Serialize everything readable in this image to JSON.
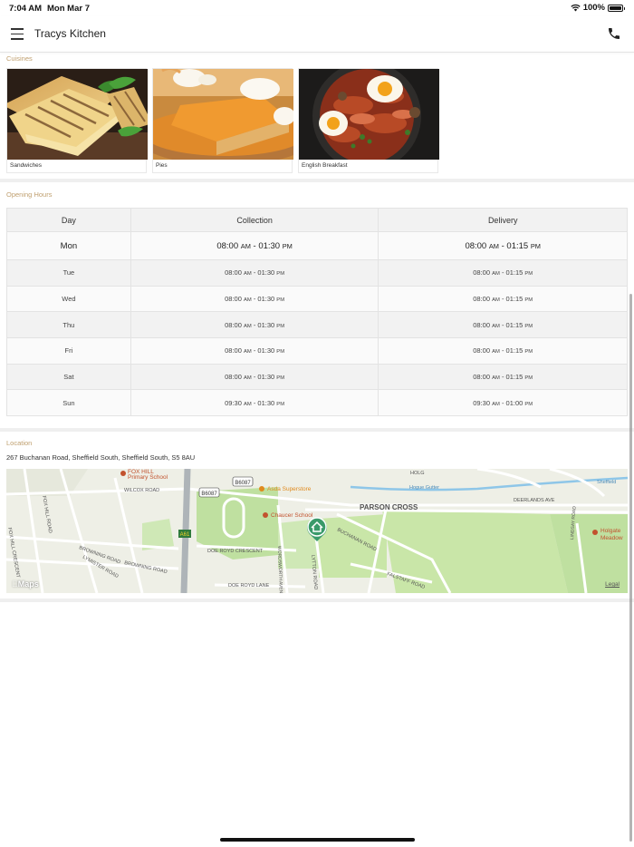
{
  "status_bar": {
    "time": "7:04 AM",
    "date": "Mon Mar 7",
    "battery": "100%"
  },
  "header": {
    "title": "Tracys Kitchen",
    "menu_icon": "hamburger-menu-icon",
    "phone_icon": "phone-icon"
  },
  "cuisines": {
    "label": "Cuisines",
    "items": [
      {
        "name": "Sandwiches"
      },
      {
        "name": "Pies"
      },
      {
        "name": "English Breakfast"
      }
    ]
  },
  "opening_hours": {
    "label": "Opening Hours",
    "columns": [
      "Day",
      "Collection",
      "Delivery"
    ],
    "rows": [
      {
        "day": "Mon",
        "collection": {
          "from": "08:00",
          "from_ampm": "AM",
          "sep": " - ",
          "to": "01:30",
          "to_ampm": "PM"
        },
        "delivery": {
          "from": "08:00",
          "from_ampm": "AM",
          "sep": " - ",
          "to": "01:15",
          "to_ampm": "PM"
        }
      },
      {
        "day": "Tue",
        "collection": {
          "from": "08:00",
          "from_ampm": "AM",
          "sep": " - ",
          "to": "01:30",
          "to_ampm": "PM"
        },
        "delivery": {
          "from": "08:00",
          "from_ampm": "AM",
          "sep": " - ",
          "to": "01:15",
          "to_ampm": "PM"
        }
      },
      {
        "day": "Wed",
        "collection": {
          "from": "08:00",
          "from_ampm": "AM",
          "sep": " - ",
          "to": "01:30",
          "to_ampm": "PM"
        },
        "delivery": {
          "from": "08:00",
          "from_ampm": "AM",
          "sep": " - ",
          "to": "01:15",
          "to_ampm": "PM"
        }
      },
      {
        "day": "Thu",
        "collection": {
          "from": "08:00",
          "from_ampm": "AM",
          "sep": " - ",
          "to": "01:30",
          "to_ampm": "PM"
        },
        "delivery": {
          "from": "08:00",
          "from_ampm": "AM",
          "sep": " - ",
          "to": "01:15",
          "to_ampm": "PM"
        }
      },
      {
        "day": "Fri",
        "collection": {
          "from": "08:00",
          "from_ampm": "AM",
          "sep": " - ",
          "to": "01:30",
          "to_ampm": "PM"
        },
        "delivery": {
          "from": "08:00",
          "from_ampm": "AM",
          "sep": " - ",
          "to": "01:15",
          "to_ampm": "PM"
        }
      },
      {
        "day": "Sat",
        "collection": {
          "from": "08:00",
          "from_ampm": "AM",
          "sep": " - ",
          "to": "01:30",
          "to_ampm": "PM"
        },
        "delivery": {
          "from": "08:00",
          "from_ampm": "AM",
          "sep": " - ",
          "to": "01:15",
          "to_ampm": "PM"
        }
      },
      {
        "day": "Sun",
        "collection": {
          "from": "09:30",
          "from_ampm": "AM",
          "sep": " - ",
          "to": "01:30",
          "to_ampm": "PM"
        },
        "delivery": {
          "from": "09:30",
          "from_ampm": "AM",
          "sep": " - ",
          "to": "01:00",
          "to_ampm": "PM"
        }
      }
    ]
  },
  "location": {
    "label": "Location",
    "address": "267 Buchanan Road, Sheffield South, Sheffield South, S5 8AU",
    "map": {
      "maps_label": "Maps",
      "legal_label": "Legal",
      "labels": {
        "fox_hill_1": "FOX HILL",
        "fox_hill_2": "Primary School",
        "wilcox_road": "WILCOX ROAD",
        "b6087_a": "B6087",
        "b6087_b": "B6087",
        "asda": "Asda Superstore",
        "chaucer": "Chaucer School",
        "parson_cross": "PARSON CROSS",
        "deerlands": "DEERLANDS AVE",
        "holgate_1": "Holgate",
        "holgate_2": "Meadow",
        "sheffield": "Sheffield",
        "hog_gutter": "Hogue Gutter",
        "a61": "A61",
        "doe_royd_crescent": "DOE ROYD CRESCENT",
        "doe_royd_lane": "DOE ROYD LANE",
        "browning_road_1": "BROWNING ROAD",
        "browning_road_2": "BROWNING ROAD",
        "lymister_road": "LYMISTER ROAD",
        "fox_hill_crescent": "FOX HILL CRESCENT",
        "fox_hill_road": "FOX HILL ROAD",
        "buchanan_road": "BUCHANAN ROAD",
        "falstaff_road": "FALSTAFF ROAD",
        "lytton_road": "LYTTON ROAD",
        "wordsworth_avenue": "WORDSWORTH AVENUE",
        "lindsay_road": "LINDSAY ROAD",
        "holgate": "HOLG"
      }
    }
  },
  "colors": {
    "section_label": "#c0a070",
    "park_green": "#bfe0a0",
    "map_pin": "#3a9a6a",
    "poi_orange": "#e08a1e",
    "poi_red": "#c2522e"
  }
}
